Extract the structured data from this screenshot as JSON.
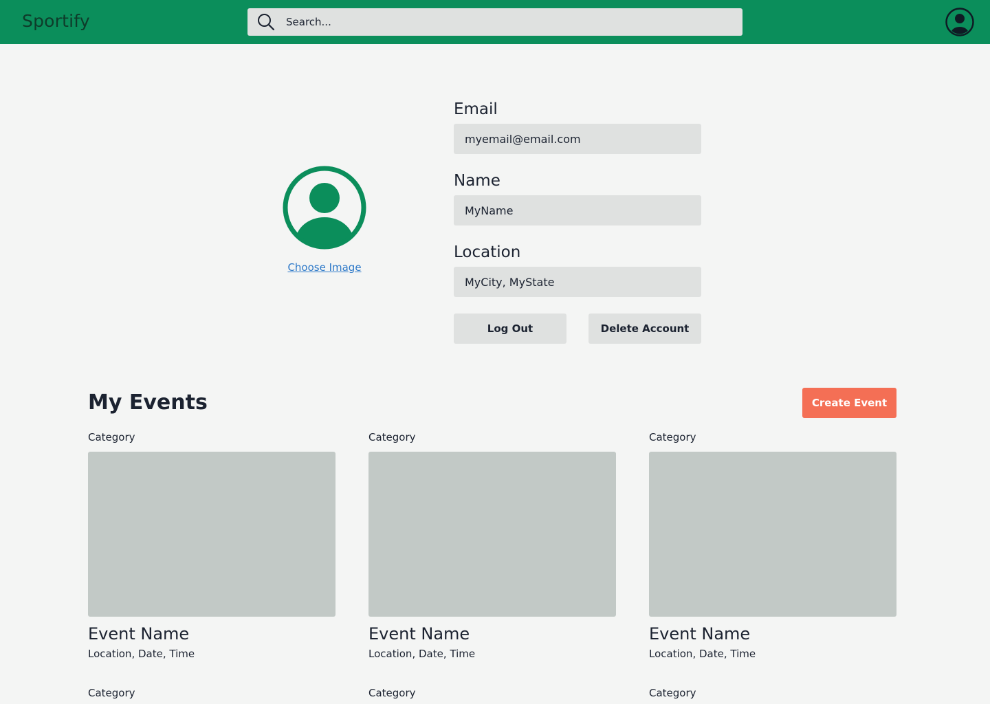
{
  "header": {
    "brand": "Sportify",
    "search_placeholder": "Search..."
  },
  "profile": {
    "choose_image_label": "Choose Image",
    "fields": {
      "email": {
        "label": "Email",
        "value": "myemail@email.com"
      },
      "name": {
        "label": "Name",
        "value": "MyName"
      },
      "location": {
        "label": "Location",
        "value": "MyCity, MyState"
      }
    },
    "logout_label": "Log Out",
    "delete_label": "Delete Account"
  },
  "events": {
    "title": "My Events",
    "create_label": "Create Event",
    "cards": [
      {
        "category": "Category",
        "name": "Event Name",
        "meta": "Location, Date, Time"
      },
      {
        "category": "Category",
        "name": "Event Name",
        "meta": "Location, Date, Time"
      },
      {
        "category": "Category",
        "name": "Event Name",
        "meta": "Location, Date, Time"
      }
    ],
    "next_row_categories": [
      "Category",
      "Category",
      "Category"
    ]
  },
  "colors": {
    "brand_green": "#0b8e5b",
    "accent_orange": "#f46f55",
    "link_blue": "#2c78c8"
  },
  "icons": {
    "search": "search-icon",
    "account": "account-circle-icon",
    "profile_picture": "user-avatar-icon"
  }
}
